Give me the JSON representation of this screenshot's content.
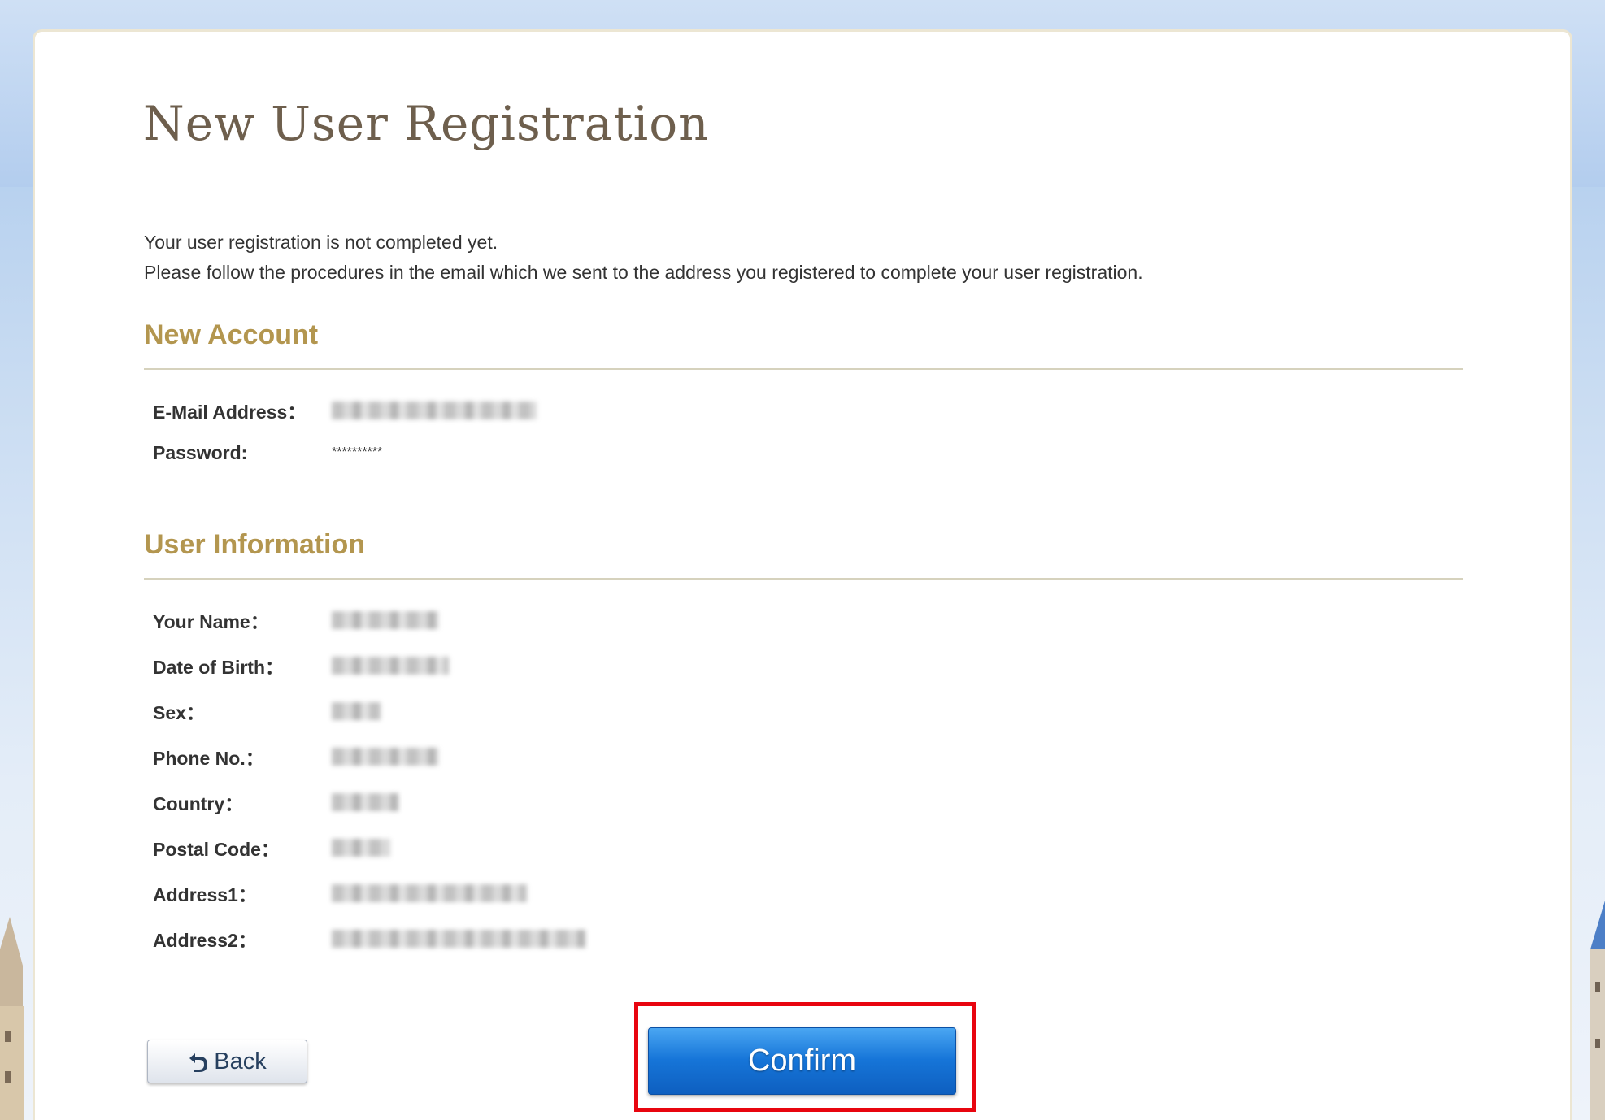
{
  "title": "New User Registration",
  "notice": {
    "line1": "Your user registration is not completed yet.",
    "line2": "Please follow the procedures in the email which we sent to the address you registered to complete your user registration."
  },
  "new_account": {
    "heading": "New Account",
    "rows": [
      {
        "label": "E-Mail Address：",
        "value": ""
      },
      {
        "label": "Password:",
        "value": "**********"
      }
    ]
  },
  "user_information": {
    "heading": "User Information",
    "rows": [
      {
        "label": "Your Name："
      },
      {
        "label": "Date of Birth："
      },
      {
        "label": "Sex："
      },
      {
        "label": "Phone No.："
      },
      {
        "label": "Country："
      },
      {
        "label": "Postal Code："
      },
      {
        "label": "Address1："
      },
      {
        "label": "Address2："
      }
    ]
  },
  "buttons": {
    "back_label": "Back",
    "confirm_label": "Confirm"
  },
  "colors": {
    "heading": "#b3964f",
    "title": "#6e5f4d",
    "confirm": "#1675d8",
    "highlight": "#e8050f"
  }
}
